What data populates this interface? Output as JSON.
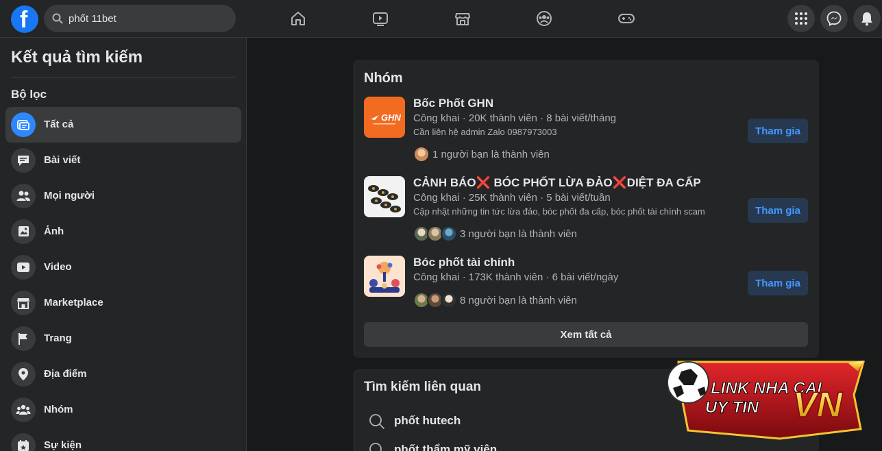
{
  "search": {
    "query": "phốt 11bet"
  },
  "sidebar": {
    "title": "Kết quả tìm kiếm",
    "filter_title": "Bộ lọc",
    "items": [
      {
        "label": "Tất cả",
        "icon": "all-results-icon",
        "active": true
      },
      {
        "label": "Bài viết",
        "icon": "posts-icon"
      },
      {
        "label": "Mọi người",
        "icon": "people-icon"
      },
      {
        "label": "Ảnh",
        "icon": "photos-icon"
      },
      {
        "label": "Video",
        "icon": "video-icon"
      },
      {
        "label": "Marketplace",
        "icon": "marketplace-icon"
      },
      {
        "label": "Trang",
        "icon": "pages-flag-icon"
      },
      {
        "label": "Địa điểm",
        "icon": "location-pin-icon"
      },
      {
        "label": "Nhóm",
        "icon": "groups-icon"
      },
      {
        "label": "Sự kiện",
        "icon": "events-icon"
      }
    ]
  },
  "groups_card": {
    "title": "Nhóm",
    "groups": [
      {
        "name": "Bốc Phốt GHN",
        "meta": "Công khai · 20K thành viên · 8 bài viết/tháng",
        "desc": "Cần liên hệ admin Zalo 0987973003",
        "friends": "1 người bạn là thành viên",
        "thumb_text": "GHN",
        "join": "Tham gia"
      },
      {
        "name": "CẢNH BÁO❌ BÓC PHỐT LỪA ĐẢO❌DIỆT ĐA CẤP",
        "meta": "Công khai · 25K thành viên · 5 bài viết/tuần",
        "desc": "Cập nhật những tin tức lừa đảo, bóc phốt đa cấp, bóc phốt tài chính scam",
        "friends": "3 người bạn là thành viên",
        "join": "Tham gia"
      },
      {
        "name": "Bóc phốt tài chính",
        "meta": "Công khai · 173K thành viên · 6 bài viết/ngày",
        "friends": "8 người bạn là thành viên",
        "join": "Tham gia"
      }
    ],
    "see_all": "Xem tất cả"
  },
  "related_card": {
    "title": "Tìm kiếm liên quan",
    "items": [
      "phốt hutech",
      "phốt thẩm mỹ viện"
    ]
  },
  "watermark": {
    "line1": "LINK NHA CAI",
    "line2": "UY TIN",
    "badge": "VN"
  },
  "colors": {
    "accent": "#2d88ff",
    "join_bg": "#263951",
    "join_text": "#4599ff",
    "bg": "#18191a",
    "surface": "#242526"
  }
}
